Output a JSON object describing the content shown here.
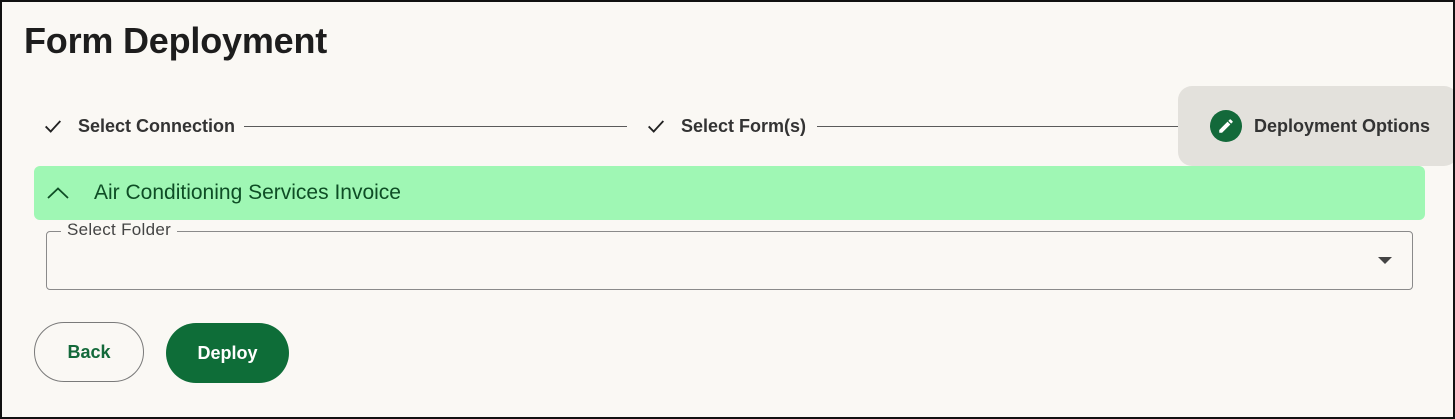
{
  "page": {
    "title": "Form Deployment"
  },
  "stepper": {
    "steps": [
      {
        "label": "Select Connection",
        "state": "completed",
        "icon": "check-icon"
      },
      {
        "label": "Select Form(s)",
        "state": "completed",
        "icon": "check-icon"
      },
      {
        "label": "Deployment Options",
        "state": "active",
        "icon": "pencil-icon"
      }
    ]
  },
  "accordion": {
    "title": "Air Conditioning Services Invoice",
    "expanded": true,
    "icon": "chevron-up-icon"
  },
  "folder_select": {
    "label": "Select Folder",
    "value": "",
    "icon": "dropdown-caret-icon"
  },
  "actions": {
    "back_label": "Back",
    "deploy_label": "Deploy"
  },
  "colors": {
    "primary": "#0e6d38",
    "accordion_bg": "#9ff7b4",
    "active_step_bg": "#e3e1dc",
    "page_bg": "#faf8f4"
  }
}
